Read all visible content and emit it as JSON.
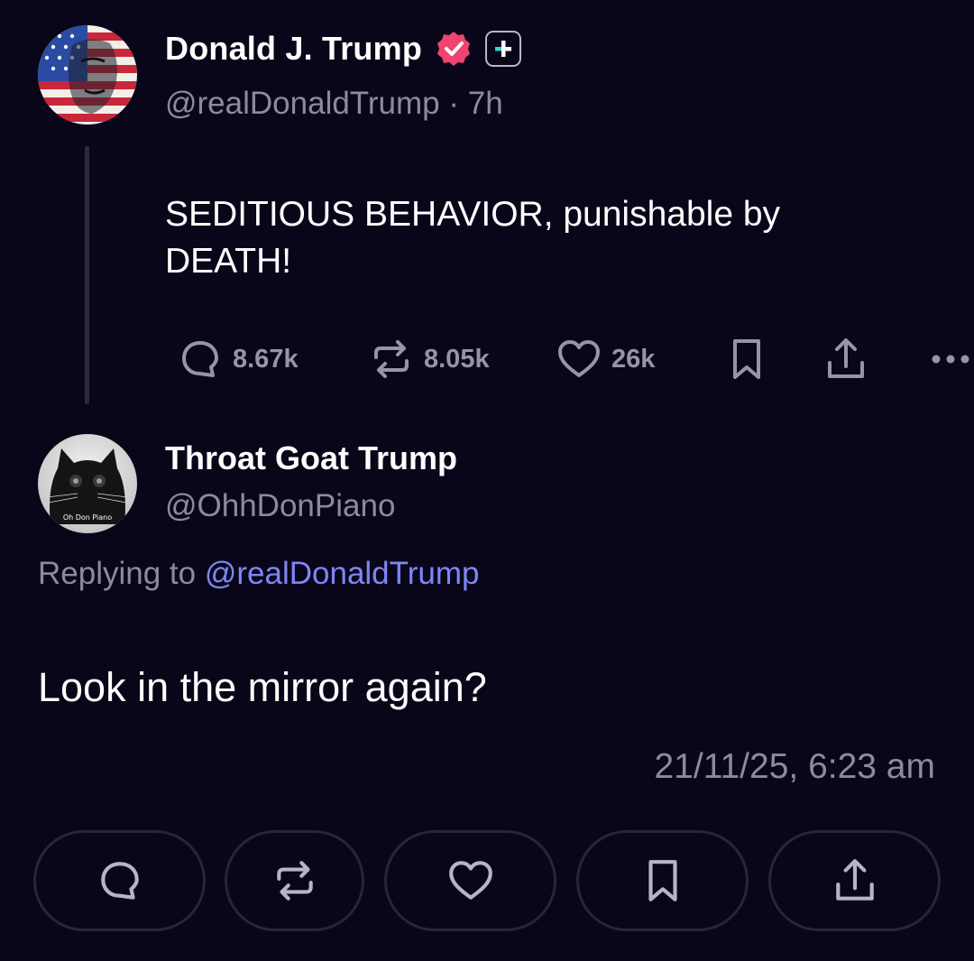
{
  "parent_post": {
    "author_name": "Donald J. Trump",
    "handle": "@realDonaldTrump",
    "separator": "·",
    "time_ago": "7h",
    "text": "SEDITIOUS BEHAVIOR, punishable by DEATH!",
    "stats": {
      "replies": "8.67k",
      "reposts": "8.05k",
      "likes": "26k"
    },
    "badge_colors": {
      "verified": "#f0436f",
      "plus_accent": "#36d6c4"
    }
  },
  "reply_post": {
    "author_name": "Throat Goat Trump",
    "handle": "@OhhDonPiano",
    "avatar_caption": "Oh Don Piano",
    "replying_prefix": "Replying to",
    "replying_to": "@realDonaldTrump",
    "text": "Look in the mirror again?",
    "timestamp": "21/11/25, 6:23 am"
  },
  "icons": {
    "reply": "speech-bubble-icon",
    "repost": "repost-arrows-icon",
    "like": "heart-icon",
    "bookmark": "bookmark-icon",
    "share": "share-upload-icon",
    "more": "ellipsis-icon"
  },
  "colors": {
    "background": "#09061a",
    "muted_text": "#8d8a9e",
    "mention": "#7f86f5",
    "pill_border": "#27253a"
  }
}
